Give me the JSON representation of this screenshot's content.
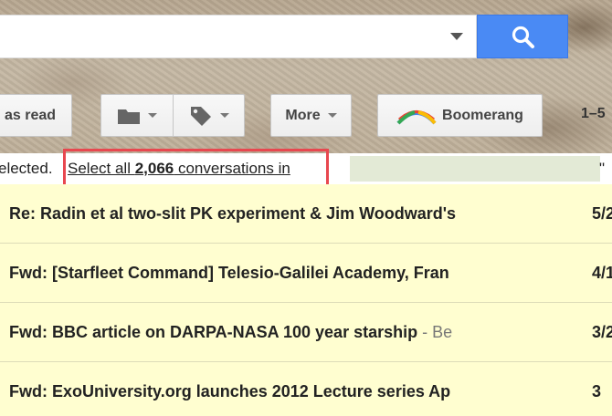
{
  "search": {
    "placeholder": "",
    "value": ""
  },
  "toolbar": {
    "mark_read_label": "as read",
    "move_icon": "folder-icon",
    "labels_icon": "label-tag-icon",
    "more_label": "More",
    "boomerang_label": "Boomerang",
    "page_count": "1–5"
  },
  "banner": {
    "prefix": "elected.",
    "select_all_prefix": "Select all ",
    "count": "2,066",
    "select_all_suffix": " conversations in",
    "suffix": "\""
  },
  "colors": {
    "accent_blue": "#4a8af4",
    "highlight_red": "#e8474f",
    "unread_row": "#fffed0"
  },
  "messages": [
    {
      "subject": "Re: Radin et al two-slit PK experiment & Jim Woodward's",
      "snippet": "",
      "date": "5/2"
    },
    {
      "subject": "Fwd: [Starfleet Command] Telesio-Galilei Academy, Fran",
      "snippet": "",
      "date": "4/1"
    },
    {
      "subject": "Fwd: BBC article on DARPA-NASA 100 year starship",
      "snippet": " - Be",
      "date": "3/2"
    },
    {
      "subject": "Fwd: ExoUniversity.org launches 2012 Lecture series Ap",
      "snippet": "",
      "date": "3"
    }
  ]
}
